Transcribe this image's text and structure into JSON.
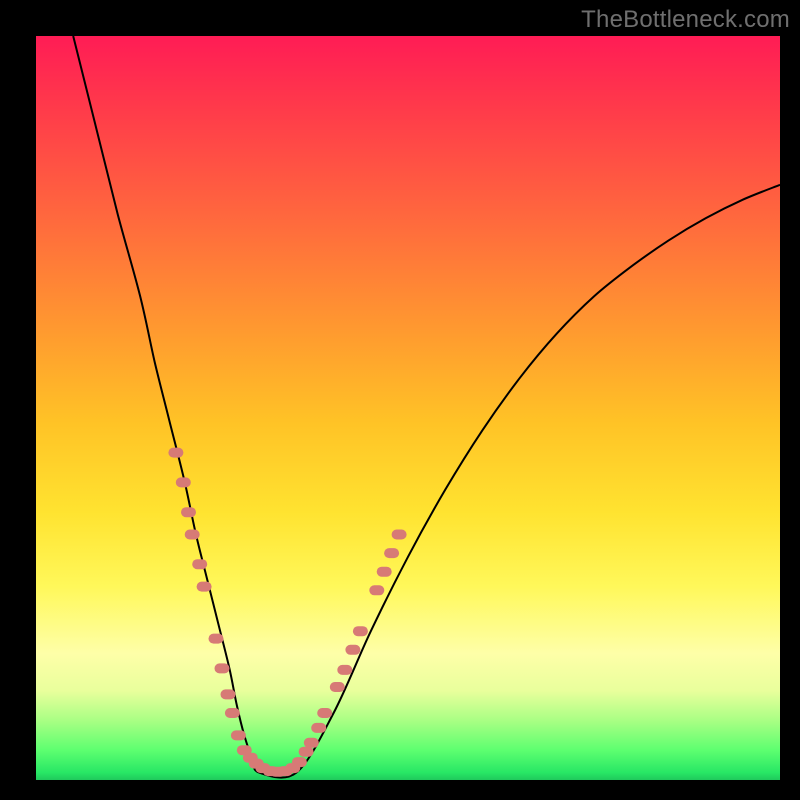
{
  "watermark": "TheBottleneck.com",
  "colors": {
    "frame": "#000000",
    "curve": "#000000",
    "markers": "#d77a76",
    "gradient_stops": [
      "#ff1c55",
      "#ff3b4a",
      "#ff6a3d",
      "#ff9b2f",
      "#ffc326",
      "#ffe330",
      "#fff85a",
      "#feffa8",
      "#e9ff9c",
      "#a9ff84",
      "#5dff70",
      "#28e765",
      "#1fc95c"
    ]
  },
  "chart_data": {
    "type": "line",
    "title": "",
    "xlabel": "",
    "ylabel": "",
    "xlim": [
      0,
      100
    ],
    "ylim": [
      0,
      100
    ],
    "grid": false,
    "legend": false,
    "series": [
      {
        "name": "bottleneck-curve",
        "x": [
          5,
          8,
          11,
          14,
          16,
          18,
          20,
          21.5,
          23,
          24.5,
          26,
          27,
          28,
          29,
          30,
          35,
          40,
          45,
          50,
          55,
          60,
          65,
          70,
          75,
          80,
          85,
          90,
          95,
          100
        ],
        "y": [
          100,
          88,
          76,
          65,
          56,
          48,
          40,
          33,
          27,
          21,
          15,
          10,
          6,
          3,
          1,
          1,
          9,
          20,
          30,
          39,
          47,
          54,
          60,
          65,
          69,
          72.5,
          75.5,
          78,
          80
        ]
      }
    ],
    "markers": [
      {
        "x": 18.8,
        "y": 44
      },
      {
        "x": 19.8,
        "y": 40
      },
      {
        "x": 20.5,
        "y": 36
      },
      {
        "x": 21.0,
        "y": 33
      },
      {
        "x": 22.0,
        "y": 29
      },
      {
        "x": 22.6,
        "y": 26
      },
      {
        "x": 24.2,
        "y": 19
      },
      {
        "x": 25.0,
        "y": 15
      },
      {
        "x": 25.8,
        "y": 11.5
      },
      {
        "x": 26.4,
        "y": 9
      },
      {
        "x": 27.2,
        "y": 6
      },
      {
        "x": 28.0,
        "y": 4
      },
      {
        "x": 28.8,
        "y": 3
      },
      {
        "x": 29.6,
        "y": 2.2
      },
      {
        "x": 30.5,
        "y": 1.6
      },
      {
        "x": 31.5,
        "y": 1.2
      },
      {
        "x": 32.5,
        "y": 1.1
      },
      {
        "x": 33.5,
        "y": 1.2
      },
      {
        "x": 34.5,
        "y": 1.6
      },
      {
        "x": 35.4,
        "y": 2.4
      },
      {
        "x": 36.3,
        "y": 3.8
      },
      {
        "x": 37.0,
        "y": 5.0
      },
      {
        "x": 38.0,
        "y": 7.0
      },
      {
        "x": 38.8,
        "y": 9.0
      },
      {
        "x": 40.5,
        "y": 12.5
      },
      {
        "x": 41.5,
        "y": 14.8
      },
      {
        "x": 42.6,
        "y": 17.5
      },
      {
        "x": 43.6,
        "y": 20
      },
      {
        "x": 45.8,
        "y": 25.5
      },
      {
        "x": 46.8,
        "y": 28
      },
      {
        "x": 47.8,
        "y": 30.5
      },
      {
        "x": 48.8,
        "y": 33
      }
    ],
    "annotations": [
      {
        "text": "TheBottleneck.com",
        "role": "watermark",
        "position": "top-right"
      }
    ]
  }
}
